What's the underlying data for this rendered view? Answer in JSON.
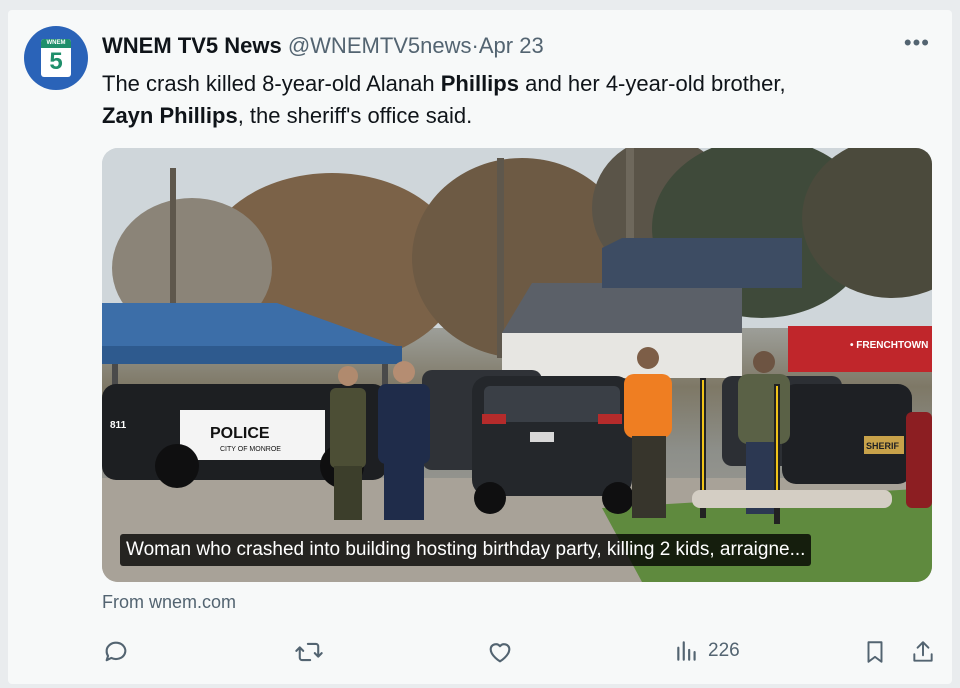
{
  "tweet": {
    "author_name": "WNEM TV5 News",
    "author_handle": "@WNEMTV5news",
    "separator": "·",
    "date": "Apr 23",
    "more_label": "•••",
    "text_parts": [
      "The crash killed 8-year-old Alanah ",
      "Phillips",
      " and her 4-year-old brother, ",
      "Zayn Phillips",
      ", the sheriff's office said."
    ],
    "avatar": {
      "badge_top": "WNEM",
      "badge_num": "5"
    }
  },
  "media": {
    "caption": "Woman who crashed into building hosting birthday party, killing 2 kids, arraigne...",
    "source": "From wnem.com",
    "scene_text": {
      "police_door": "POLICE",
      "police_sub": "CITY OF MONROE",
      "car_number": "811",
      "firetruck": "• FRENCHTOWN",
      "sheriff_door": "SHERIF"
    }
  },
  "actions": {
    "reply_icon": "reply-icon",
    "retweet_icon": "retweet-icon",
    "like_icon": "heart-icon",
    "views_icon": "views-icon",
    "views_count": "226",
    "bookmark_icon": "bookmark-icon",
    "share_icon": "share-icon"
  },
  "colors": {
    "text": "#0f1419",
    "muted": "#536471",
    "avatar_bg": "#2a63b8",
    "caption_bg": "#000000"
  }
}
